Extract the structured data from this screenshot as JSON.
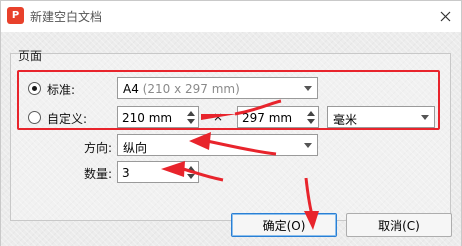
{
  "window": {
    "title": "新建空白文档",
    "app_icon_glyph": "P",
    "close_icon": "close-icon"
  },
  "page_group": {
    "label": "页面",
    "standard": {
      "label": "标准:",
      "selected": true,
      "value": "A4",
      "hint": "(210 x 297 mm)"
    },
    "custom": {
      "label": "自定义:",
      "selected": false,
      "width": "210 mm",
      "times": "×",
      "height": "297 mm",
      "unit": "毫米"
    },
    "orientation": {
      "label": "方向:",
      "value": "纵向"
    },
    "count": {
      "label": "数量:",
      "value": "3"
    }
  },
  "buttons": {
    "ok": "确定(O)",
    "cancel": "取消(C)"
  },
  "colors": {
    "highlight_red": "#e8242c",
    "app_icon": "#e8412b",
    "default_button_border": "#2a7fd4"
  }
}
